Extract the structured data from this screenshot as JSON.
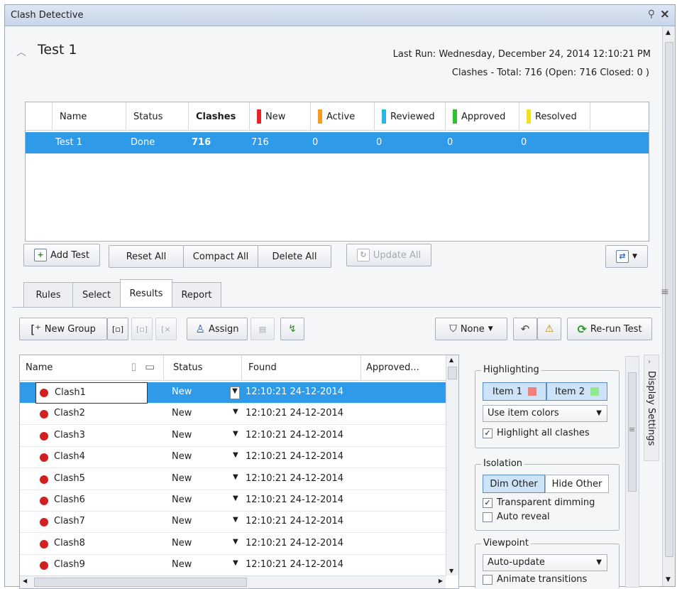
{
  "window": {
    "title": "Clash Detective"
  },
  "test": {
    "name": "Test 1",
    "last_run": "Last Run:  Wednesday, December 24, 2014 12:10:21 PM",
    "clashes_summary": "Clashes - Total:  716  (Open:  716  Closed:  0 )"
  },
  "tests_table": {
    "headers": [
      "Name",
      "Status",
      "Clashes",
      "New",
      "Active",
      "Reviewed",
      "Approved",
      "Resolved"
    ],
    "colors": {
      "new": "#e8232a",
      "active": "#f39a1f",
      "reviewed": "#29b7e8",
      "approved": "#2fc12f",
      "resolved": "#f2e21b"
    },
    "rows": [
      {
        "name": "Test 1",
        "status": "Done",
        "clashes": "716",
        "new": "716",
        "active": "0",
        "reviewed": "0",
        "approved": "0",
        "resolved": "0"
      }
    ]
  },
  "toolbar": {
    "add_test": "Add Test",
    "reset_all": "Reset All",
    "compact_all": "Compact All",
    "delete_all": "Delete All",
    "update_all": "Update All"
  },
  "tabs": [
    "Rules",
    "Select",
    "Results",
    "Report"
  ],
  "results_toolbar": {
    "new_group": "New Group",
    "assign": "Assign",
    "none": "None",
    "rerun": "Re-run Test"
  },
  "results": {
    "headers": [
      "Name",
      "Status",
      "Found",
      "Approved..."
    ],
    "rows": [
      {
        "name": "Clash1",
        "status": "New",
        "found": "12:10:21 24-12-2014"
      },
      {
        "name": "Clash2",
        "status": "New",
        "found": "12:10:21 24-12-2014"
      },
      {
        "name": "Clash3",
        "status": "New",
        "found": "12:10:21 24-12-2014"
      },
      {
        "name": "Clash4",
        "status": "New",
        "found": "12:10:21 24-12-2014"
      },
      {
        "name": "Clash5",
        "status": "New",
        "found": "12:10:21 24-12-2014"
      },
      {
        "name": "Clash6",
        "status": "New",
        "found": "12:10:21 24-12-2014"
      },
      {
        "name": "Clash7",
        "status": "New",
        "found": "12:10:21 24-12-2014"
      },
      {
        "name": "Clash8",
        "status": "New",
        "found": "12:10:21 24-12-2014"
      },
      {
        "name": "Clash9",
        "status": "New",
        "found": "12:10:21 24-12-2014"
      }
    ]
  },
  "display_settings": {
    "tab_label": "Display Settings",
    "highlighting": {
      "title": "Highlighting",
      "item1": "Item 1",
      "item2": "Item 2",
      "item1_color": "#f08080",
      "item2_color": "#90e890",
      "mode": "Use item colors",
      "highlight_all": "Highlight all clashes"
    },
    "isolation": {
      "title": "Isolation",
      "dim_other": "Dim Other",
      "hide_other": "Hide Other",
      "transparent": "Transparent dimming",
      "auto_reveal": "Auto reveal"
    },
    "viewpoint": {
      "title": "Viewpoint",
      "mode": "Auto-update",
      "animate": "Animate transitions"
    }
  }
}
